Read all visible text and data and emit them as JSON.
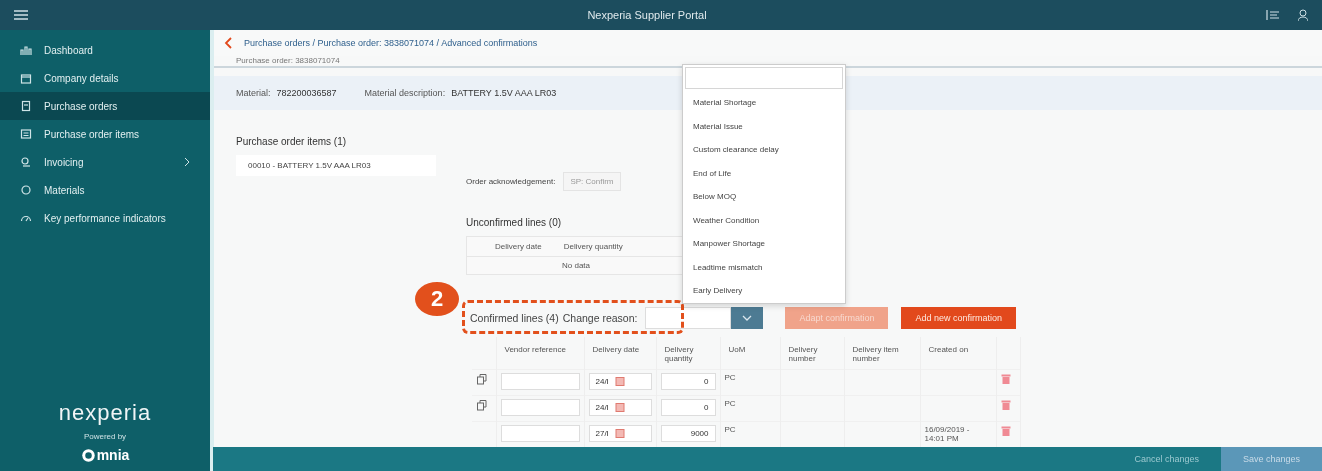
{
  "top_bar": {
    "title": "Nexperia Supplier Portal"
  },
  "sidebar": {
    "items": [
      {
        "label": "Dashboard",
        "selected": false,
        "has_submenu": false
      },
      {
        "label": "Company details",
        "selected": false,
        "has_submenu": false
      },
      {
        "label": "Purchase orders",
        "selected": true,
        "has_submenu": false
      },
      {
        "label": "Purchase order items",
        "selected": false,
        "has_submenu": false
      },
      {
        "label": "Invoicing",
        "selected": false,
        "has_submenu": true
      },
      {
        "label": "Materials",
        "selected": false,
        "has_submenu": false
      },
      {
        "label": "Key performance indicators",
        "selected": false,
        "has_submenu": false
      }
    ],
    "logo": "nexperia",
    "powered_by": "Powered by",
    "partner": "mnia"
  },
  "breadcrumb": {
    "parts": [
      "Purchase orders / Purchase order: 3838071074 / Advanced confirmations"
    ]
  },
  "header": {
    "title": "Purchase order: 3838071074"
  },
  "material_bar": {
    "material_label": "Material:",
    "material": "782200036587",
    "description_label": "Material description:",
    "description": "BATTERY 1.5V AAA LR03"
  },
  "items_panel": {
    "title": "Purchase order items (1)",
    "items": [
      {
        "label": "00010 - BATTERY 1.5V AAA LR03",
        "selected": true
      }
    ]
  },
  "acknowledgement": {
    "label": "Order acknowledgement:",
    "value": "SP: Confirm"
  },
  "unconfirmed": {
    "title": "Unconfirmed lines (0)",
    "columns": [
      "Delivery date",
      "Delivery quantity"
    ],
    "empty_text": "No data"
  },
  "confirmed": {
    "title": "Confirmed lines (4)",
    "reason_label": "Change reason:",
    "buttons": [
      {
        "label": "Adapt confirmation",
        "disabled": true
      },
      {
        "label": "Add new confirmation",
        "disabled": false
      }
    ],
    "columns": [
      "Vendor reference",
      "Delivery date",
      "Delivery quantity",
      "UoM",
      "Delivery number",
      "Delivery item number",
      "Created on"
    ],
    "rows": [
      {
        "copyable": true,
        "date": "24/I",
        "quantity": "0",
        "uom": "PC"
      },
      {
        "copyable": true,
        "date": "24/I",
        "quantity": "0",
        "uom": "PC"
      },
      {
        "copyable": false,
        "date": "27/I",
        "quantity": "9000",
        "uom": "PC",
        "created_on": "16/09/2019 - 14:01 PM"
      }
    ]
  },
  "reason_dropdown": {
    "options": [
      "Material Shortage",
      "Material Issue",
      "Custom clearance delay",
      "End of Life",
      "Below MOQ",
      "Weather Condition",
      "Manpower Shortage",
      "Leadtime mismatch",
      "Early Delivery"
    ]
  },
  "annotation": {
    "number": "2"
  },
  "footer": {
    "buttons": [
      {
        "label": "Cancel changes",
        "kind": "plain"
      },
      {
        "label": "Save changes",
        "kind": "primary"
      }
    ]
  }
}
